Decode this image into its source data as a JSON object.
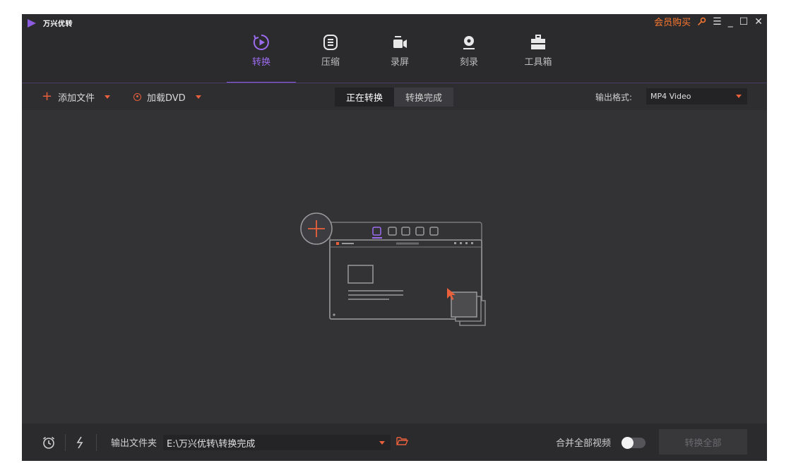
{
  "app": {
    "name": "万兴优转"
  },
  "window_controls": {
    "vip_label": "会员购买",
    "menu_glyph": "☰",
    "minimize_glyph": "_",
    "maximize_glyph": "☐",
    "close_glyph": "✕"
  },
  "nav": {
    "active": "convert",
    "tabs": [
      {
        "id": "convert",
        "label": "转换",
        "icon": "convert-icon"
      },
      {
        "id": "compress",
        "label": "压缩",
        "icon": "compress-icon"
      },
      {
        "id": "record",
        "label": "录屏",
        "icon": "record-screen-icon"
      },
      {
        "id": "burn",
        "label": "刻录",
        "icon": "burn-disc-icon"
      },
      {
        "id": "toolbox",
        "label": "工具箱",
        "icon": "toolbox-icon"
      }
    ]
  },
  "toolbar": {
    "add_file_label": "添加文件",
    "load_dvd_label": "加载DVD",
    "segments": [
      {
        "label": "正在转换",
        "active": true
      },
      {
        "label": "转换完成",
        "active": false
      }
    ],
    "output_format_label": "输出格式:",
    "output_format_value": "MP4 Video"
  },
  "footer": {
    "output_folder_label": "输出文件夹",
    "output_folder_path": "E:\\万兴优转\\转换完成",
    "merge_label": "合并全部视频",
    "merge_enabled": false,
    "convert_all_label": "转换全部"
  },
  "colors": {
    "accent": "#8c5ce0",
    "orange": "#ff7a2e",
    "red": "#e8603c",
    "bg": "#333235",
    "header_bg": "#2b2a2d"
  }
}
